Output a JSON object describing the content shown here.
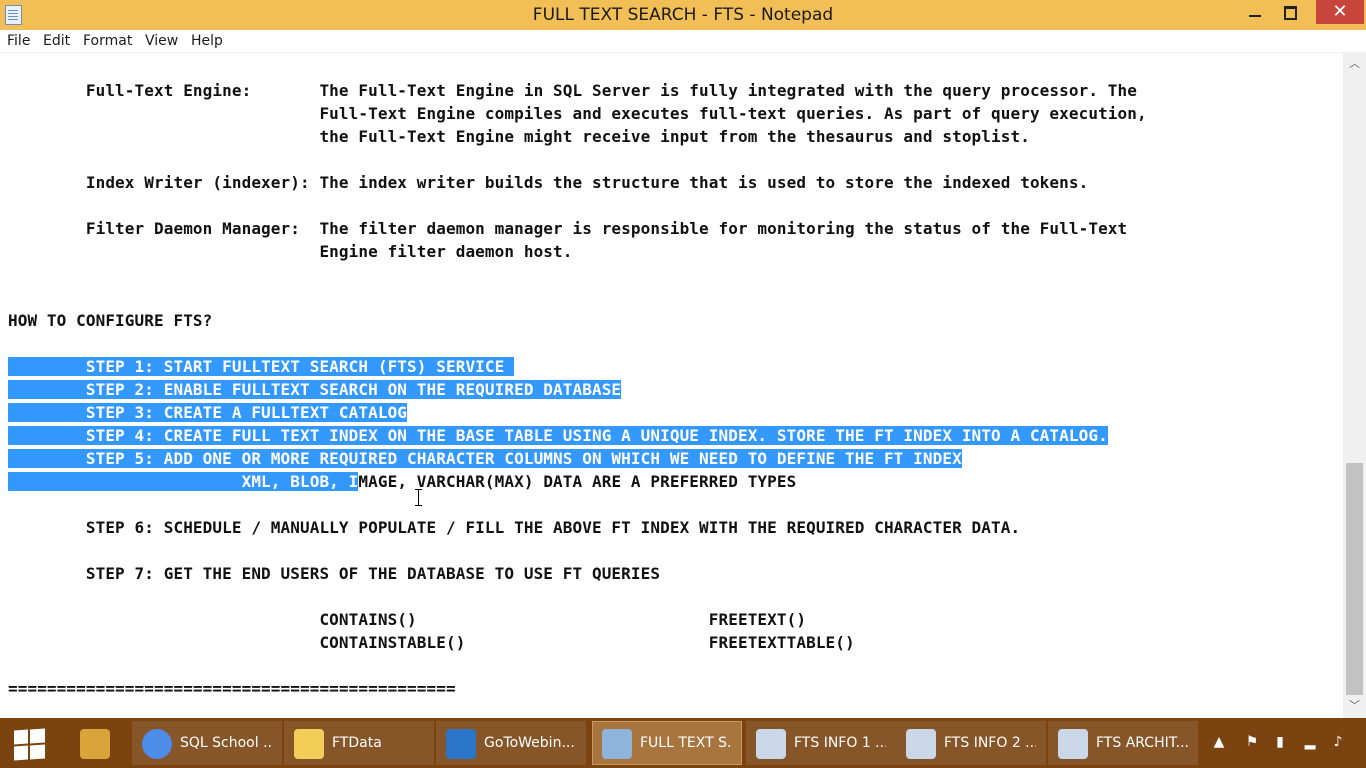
{
  "window": {
    "title": "FULL TEXT SEARCH - FTS - Notepad",
    "close_glyph": "✕"
  },
  "menu": [
    "File",
    "Edit",
    "Format",
    "View",
    "Help"
  ],
  "document": {
    "lines": [
      {
        "text": "        Full-Text Engine:       The Full-Text Engine in SQL Server is fully integrated with the query processor. The"
      },
      {
        "text": "                                Full-Text Engine compiles and executes full-text queries. As part of query execution,"
      },
      {
        "text": "                                the Full-Text Engine might receive input from the thesaurus and stoplist."
      },
      {
        "text": ""
      },
      {
        "text": "        Index Writer (indexer): The index writer builds the structure that is used to store the indexed tokens."
      },
      {
        "text": ""
      },
      {
        "text": "        Filter Daemon Manager:  The filter daemon manager is responsible for monitoring the status of the Full-Text"
      },
      {
        "text": "                                Engine filter daemon host."
      },
      {
        "text": ""
      },
      {
        "text": ""
      },
      {
        "text": "HOW TO CONFIGURE FTS?"
      },
      {
        "text": ""
      },
      {
        "selected": "        STEP 1: START FULLTEXT SEARCH (FTS) SERVICE ",
        "text": ""
      },
      {
        "selected": "        STEP 2: ENABLE FULLTEXT SEARCH ON THE REQUIRED DATABASE",
        "text": ""
      },
      {
        "selected": "        STEP 3: CREATE A FULLTEXT CATALOG",
        "text": ""
      },
      {
        "selected": "        STEP 4: CREATE FULL TEXT INDEX ON THE BASE TABLE USING A UNIQUE INDEX. STORE THE FT INDEX INTO A CATALOG.",
        "text": ""
      },
      {
        "selected": "        STEP 5: ADD ONE OR MORE REQUIRED CHARACTER COLUMNS ON WHICH WE NEED TO DEFINE THE FT INDEX",
        "text": ""
      },
      {
        "selected": "                        XML, BLOB, I",
        "text": "MAGE, VARCHAR(MAX) DATA ARE A PREFERRED TYPES"
      },
      {
        "text": ""
      },
      {
        "text": "        STEP 6: SCHEDULE / MANUALLY POPULATE / FILL THE ABOVE FT INDEX WITH THE REQUIRED CHARACTER DATA."
      },
      {
        "text": ""
      },
      {
        "text": "        STEP 7: GET THE END USERS OF THE DATABASE TO USE FT QUERIES"
      },
      {
        "text": ""
      },
      {
        "text": "                                CONTAINS()                              FREETEXT()"
      },
      {
        "text": "                                CONTAINSTABLE()                         FREETEXTTABLE()"
      },
      {
        "text": ""
      },
      {
        "text": "=============================================="
      }
    ]
  },
  "scrollbar": {
    "up_glyph": "︿",
    "down_glyph": "﹀"
  },
  "taskbar": {
    "apps": [
      {
        "label": "",
        "icon": "tools-icon",
        "color": "#d9a43a",
        "state": "pinned"
      },
      {
        "label": "SQL School ...",
        "icon": "chrome-icon",
        "color": "#4b8de8",
        "state": "open"
      },
      {
        "label": "FTData",
        "icon": "folder-icon",
        "color": "#f3cd58",
        "state": "open"
      },
      {
        "label": "GoToWebin...",
        "icon": "gotowebinar-icon",
        "color": "#2c76c9",
        "state": "open"
      },
      {
        "label": "FULL TEXT S...",
        "icon": "notepad-icon",
        "color": "#8fb4dc",
        "state": "active"
      },
      {
        "label": "FTS INFO 1 ...",
        "icon": "paint-icon",
        "color": "#c9d7e8",
        "state": "open"
      },
      {
        "label": "FTS INFO 2 ...",
        "icon": "paint-icon",
        "color": "#c9d7e8",
        "state": "open"
      },
      {
        "label": "FTS ARCHIT...",
        "icon": "paint-icon",
        "color": "#c9d7e8",
        "state": "open"
      }
    ],
    "tray": [
      {
        "icon": "show-hidden-icons-icon",
        "glyph": "▲"
      },
      {
        "icon": "action-center-icon",
        "glyph": "⚑"
      },
      {
        "icon": "power-icon",
        "glyph": "▮"
      },
      {
        "icon": "network-icon",
        "glyph": "▂"
      },
      {
        "icon": "volume-icon",
        "glyph": "♪"
      }
    ]
  }
}
